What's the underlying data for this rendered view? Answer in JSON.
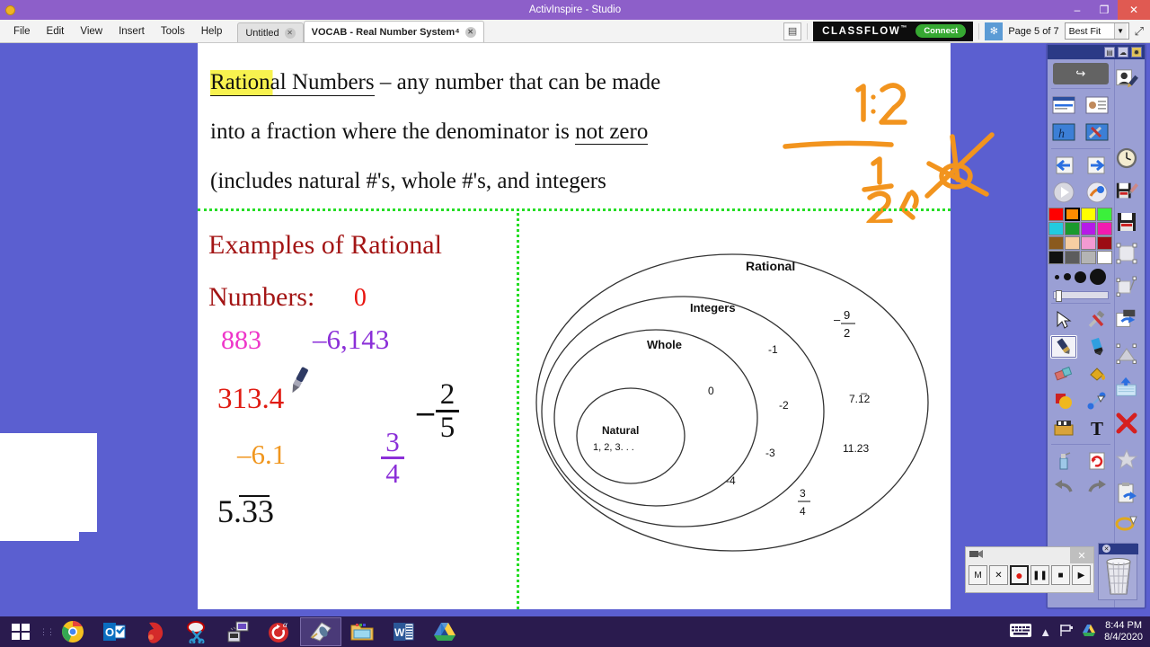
{
  "window": {
    "title": "ActivInspire - Studio",
    "app_icon": "activinspire-icon",
    "minimize": "–",
    "maximize": "❐",
    "close": "✕"
  },
  "menu": {
    "items": [
      "File",
      "Edit",
      "View",
      "Insert",
      "Tools",
      "Help"
    ]
  },
  "tabs": [
    {
      "label": "Untitled",
      "close": "✕",
      "active": false
    },
    {
      "label": "VOCAB - Real Number System⁴",
      "close": "✕",
      "active": true
    }
  ],
  "toolbar_right": {
    "notes_button": "▤",
    "classflow_word": "CLASSFLOW",
    "classflow_tm": "™",
    "classflow_connect": "Connect",
    "flow_icon": "✻",
    "page_label": "Page 5 of 7",
    "zoom_value": "Best Fit",
    "zoom_arrow": "▼",
    "expand_icon": "⤢"
  },
  "page": {
    "definition": {
      "term": "Rational Numbers",
      "line1_rest": " – any number that can be made",
      "line2_pre": "into a fraction where the denominator is ",
      "line2_underlined": "not zero",
      "line3": "(includes natural #'s, whole #'s, and integers"
    },
    "ink_annotations": [
      {
        "name": "ratio-one-to-two",
        "text": "1:2"
      },
      {
        "name": "fraction-one-half",
        "text": "1/2"
      },
      {
        "name": "crossed-out-zero",
        "text": "0 crossed out"
      }
    ],
    "examples": {
      "heading_line1": "Examples of Rational",
      "heading_line2": "Numbers:",
      "values": [
        {
          "text": "0",
          "color": "#e8140f"
        },
        {
          "text": "883",
          "color": "#ee35c9"
        },
        {
          "text": "–6,143",
          "color": "#8b2fd8"
        },
        {
          "text": "313.4",
          "color": "#e01b12"
        },
        {
          "text": "–6.1",
          "color": "#f0961e"
        },
        {
          "text": "5.33",
          "color": "#111111"
        }
      ],
      "fractions": [
        {
          "name": "three-fourths",
          "numerator": "3",
          "denominator": "4",
          "sign": "",
          "color": "#8b2fd8"
        },
        {
          "name": "negative-two-fifths",
          "numerator": "2",
          "denominator": "5",
          "sign": "–",
          "color": "#111111"
        }
      ]
    },
    "venn": {
      "labels": [
        "Rational",
        "Integers",
        "Whole",
        "Natural"
      ],
      "natural_items": "1, 2, 3. . .",
      "whole_value": "0",
      "integer_values": [
        "-1",
        "-2",
        "-3",
        "-4"
      ],
      "rational_values": [
        "7.1̅2",
        "11.23"
      ],
      "rational_fractions": [
        {
          "sign": "–",
          "numerator": "9",
          "denominator": "2"
        },
        {
          "sign": "",
          "numerator": "3",
          "denominator": "4"
        }
      ]
    }
  },
  "palette": {
    "header_buttons": [
      "▤",
      "☁",
      "✹"
    ],
    "share_button": "↪",
    "tools_top": [
      "browser-icon",
      "properties-icon",
      "annotate-icon",
      "tools-icon"
    ],
    "nav": [
      "previous-page-icon",
      "next-page-icon"
    ],
    "media": [
      "play-icon",
      "presentation-tools-icon"
    ],
    "colors": [
      "#ff0000",
      "#ff8c00",
      "#ffff00",
      "#3bf03b",
      "#22cbe0",
      "#1a9a2e",
      "#b51ae8",
      "#f21bb0",
      "#8a5a1e",
      "#f6ceA2",
      "#f39ad2",
      "#9c0c14",
      "#101010",
      "#5c5c5c",
      "#b4b4b4",
      "#ffffff"
    ],
    "selected_color": "#ff8c00",
    "pen_widths": [
      "2",
      "4",
      "8",
      "14"
    ],
    "tools": [
      "select-icon",
      "hammer-tools-icon",
      "pen-icon",
      "highlighter-icon",
      "eraser-icon",
      "fill-icon",
      "shapes-icon",
      "connector-icon",
      "media-icon",
      "text-icon",
      "spray-clear-icon",
      "reset-page-icon",
      "undo-icon",
      "redo-icon"
    ],
    "selected_tool": "pen-icon",
    "right_column": [
      "profile-pen-icon",
      "clock-icon",
      "save-as-icon",
      "save-icon",
      "select-area-icon",
      "transform-icon",
      "duplicate-icon",
      "group-icon",
      "open-icon",
      "delete-icon",
      "favorite-icon",
      "paste-icon",
      "rubber-band-icon"
    ]
  },
  "recorder": {
    "camera_icon": "📹",
    "close": "✕",
    "buttons": [
      {
        "name": "mode-button",
        "label": "M"
      },
      {
        "name": "cancel-button",
        "label": "✕"
      },
      {
        "name": "record-button",
        "label": "●",
        "active": true
      },
      {
        "name": "pause-button",
        "label": "❚❚"
      },
      {
        "name": "stop-button",
        "label": "■"
      },
      {
        "name": "play-button",
        "label": "▶"
      }
    ]
  },
  "trash": {
    "name": "trash-can",
    "close": "✕"
  },
  "taskbar": {
    "start": "⊞",
    "apps": [
      {
        "name": "chrome-icon",
        "glyph": "◉",
        "active": false
      },
      {
        "name": "outlook-icon",
        "glyph": "O",
        "active": false
      },
      {
        "name": "red-app-icon",
        "glyph": "❦",
        "active": false
      },
      {
        "name": "snipping-tool-icon",
        "glyph": "✂",
        "active": false
      },
      {
        "name": "remote-desktop-icon",
        "glyph": "▤",
        "active": false
      },
      {
        "name": "alpha-app-icon",
        "glyph": "α",
        "active": false
      },
      {
        "name": "activinspire-icon",
        "glyph": "✎",
        "active": true
      },
      {
        "name": "file-explorer-icon",
        "glyph": "🗂",
        "active": false
      },
      {
        "name": "word-icon",
        "glyph": "W",
        "active": false
      },
      {
        "name": "google-drive-icon",
        "glyph": "▲",
        "active": false
      }
    ],
    "tray": [
      "keyboard-icon",
      "show-hidden-icon",
      "network-icon",
      "drive-icon"
    ],
    "time": "8:44 PM",
    "date": "8/4/2020"
  },
  "colors": {
    "desktop": "#5b5fd0",
    "titlebar": "#8d5fc9",
    "taskbar": "#2a1b4e",
    "guide_green": "#25dd25",
    "ink_orange": "#f2941e",
    "heading_dark_red": "#a31515"
  }
}
